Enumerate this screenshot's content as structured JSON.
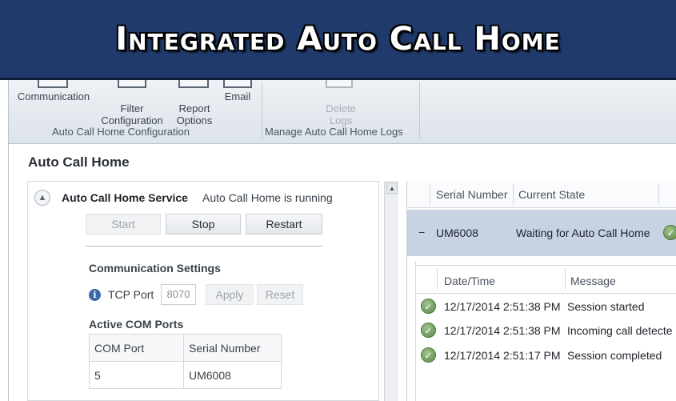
{
  "banner": {
    "title": "Integrated Auto Call Home"
  },
  "ribbon": {
    "config_buttons": [
      {
        "label": "Communication"
      },
      {
        "label": "Filter\nConfiguration"
      },
      {
        "label": "Report\nOptions"
      },
      {
        "label": "Email"
      }
    ],
    "config_group_label": "Auto Call Home Configuration",
    "logs_buttons": [
      {
        "label": "Delete\nLogs"
      }
    ],
    "logs_group_label": "Manage Auto Call Home Logs"
  },
  "page": {
    "title": "Auto Call Home"
  },
  "service": {
    "name": "Auto Call Home Service",
    "status": "Auto Call Home is running",
    "buttons": {
      "start": "Start",
      "stop": "Stop",
      "restart": "Restart"
    }
  },
  "communication": {
    "title": "Communication Settings",
    "tcp_label": "TCP Port",
    "tcp_value": "8070",
    "apply": "Apply",
    "reset": "Reset"
  },
  "com_ports": {
    "title": "Active COM Ports",
    "headers": [
      "COM Port",
      "Serial Number"
    ],
    "rows": [
      [
        "5",
        "UM6008"
      ]
    ]
  },
  "devices": {
    "headers": [
      "Serial Number",
      "Current State"
    ],
    "row": {
      "toggle": "−",
      "serial": "UM6008",
      "state": "Waiting for Auto Call Home"
    }
  },
  "log": {
    "headers": [
      "Date/Time",
      "Message"
    ],
    "rows": [
      {
        "datetime": "12/17/2014 2:51:38 PM",
        "message": "Session started"
      },
      {
        "datetime": "12/17/2014 2:51:38 PM",
        "message": "Incoming call detecte"
      },
      {
        "datetime": "12/17/2014 2:51:17 PM",
        "message": "Session completed"
      }
    ]
  },
  "colors": {
    "banner": "#1f3a6b",
    "ribbon": "#dde3ea",
    "selected_row": "#c7d3e3",
    "success": "#5c8a4a"
  }
}
